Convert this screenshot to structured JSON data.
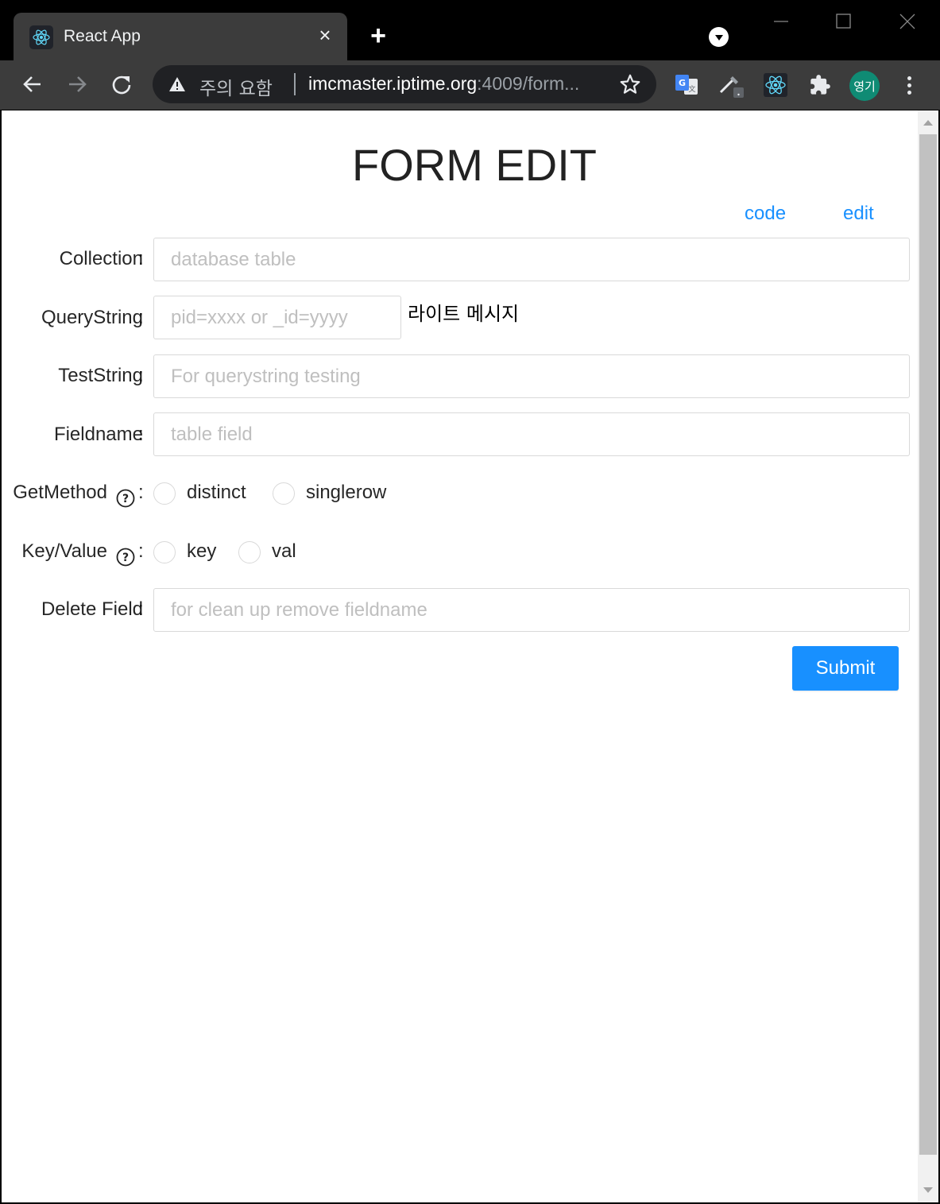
{
  "browser": {
    "tab_title": "React App",
    "tab_close": "×",
    "new_tab": "+",
    "security_text": "주의 요함",
    "url_host": "imcmaster.iptime.org",
    "url_rest": ":4009/form...",
    "profile_initials": "영기"
  },
  "page": {
    "title": "FORM EDIT",
    "links": {
      "code": "code",
      "edit": "edit"
    }
  },
  "form": {
    "colon": ":",
    "collection": {
      "label": "Collection",
      "placeholder": "database table"
    },
    "querystring": {
      "label": "QueryString",
      "placeholder": "pid=xxxx or _id=yyyy",
      "message": "라이트 메시지"
    },
    "teststring": {
      "label": "TestString",
      "placeholder": "For querystring testing"
    },
    "fieldname": {
      "label": "Fieldname",
      "placeholder": "table field"
    },
    "getmethod": {
      "label": "GetMethod",
      "options": [
        "distinct",
        "singlerow"
      ]
    },
    "keyvalue": {
      "label": "Key/Value",
      "options": [
        "key",
        "val"
      ]
    },
    "deletefield": {
      "label": "Delete Field",
      "placeholder": "for clean up remove fieldname"
    },
    "submit_label": "Submit"
  },
  "colors": {
    "primary": "#1890ff",
    "chrome_dark": "#3c3c3c",
    "avatar": "#0f8b74"
  }
}
